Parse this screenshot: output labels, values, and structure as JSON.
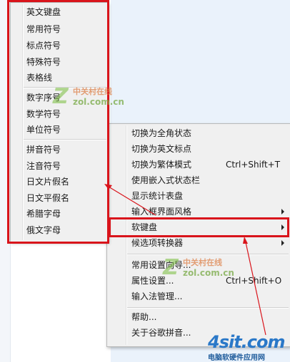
{
  "main_menu": {
    "items": [
      {
        "label": "切换为全角状态",
        "shortcut": "",
        "has_submenu": false
      },
      {
        "label": "切换为英文标点",
        "shortcut": "",
        "has_submenu": false
      },
      {
        "label": "切换为繁体模式",
        "shortcut": "Ctrl+Shift+T",
        "has_submenu": false
      },
      {
        "label": "使用嵌入式状态栏",
        "shortcut": "",
        "has_submenu": false
      },
      {
        "label": "显示统计表盘",
        "shortcut": "",
        "has_submenu": false
      },
      {
        "label": "输入框界面风格",
        "shortcut": "",
        "has_submenu": true
      },
      {
        "label": "软键盘",
        "shortcut": "",
        "has_submenu": true
      },
      {
        "label": "候选项转换器",
        "shortcut": "",
        "has_submenu": true
      },
      {
        "label": "常用设置向导...",
        "shortcut": "",
        "has_submenu": false
      },
      {
        "label": "属性设置...",
        "shortcut": "Ctrl+Shift+O",
        "has_submenu": false
      },
      {
        "label": "输入法管理...",
        "shortcut": "",
        "has_submenu": false
      },
      {
        "label": "帮助...",
        "shortcut": "",
        "has_submenu": false
      },
      {
        "label": "关于谷歌拼音...",
        "shortcut": "",
        "has_submenu": false
      }
    ]
  },
  "soft_keyboard_menu": {
    "items": [
      {
        "label": "英文键盘"
      },
      {
        "label": "常用符号"
      },
      {
        "label": "标点符号"
      },
      {
        "label": "特殊符号"
      },
      {
        "label": "表格线"
      },
      {
        "label": "数字序号"
      },
      {
        "label": "数学符号"
      },
      {
        "label": "单位符号"
      },
      {
        "label": "拼音符号"
      },
      {
        "label": "注音符号"
      },
      {
        "label": "日文片假名"
      },
      {
        "label": "日文平假名"
      },
      {
        "label": "希腊字母"
      },
      {
        "label": "俄文字母"
      }
    ]
  },
  "watermark": {
    "cn": "中关村在线",
    "domain": "zol.com.cn"
  },
  "site_logo": {
    "main": "4sit.com",
    "tagline": "电脑软硬件应用网"
  },
  "colors": {
    "highlight": "#d9141b",
    "menu_bg": "#f0f0f0",
    "page_bg": "#eaf2fb"
  },
  "icons": {
    "submenu": "chevron-right-icon",
    "watermark": "zol-logo-icon"
  }
}
